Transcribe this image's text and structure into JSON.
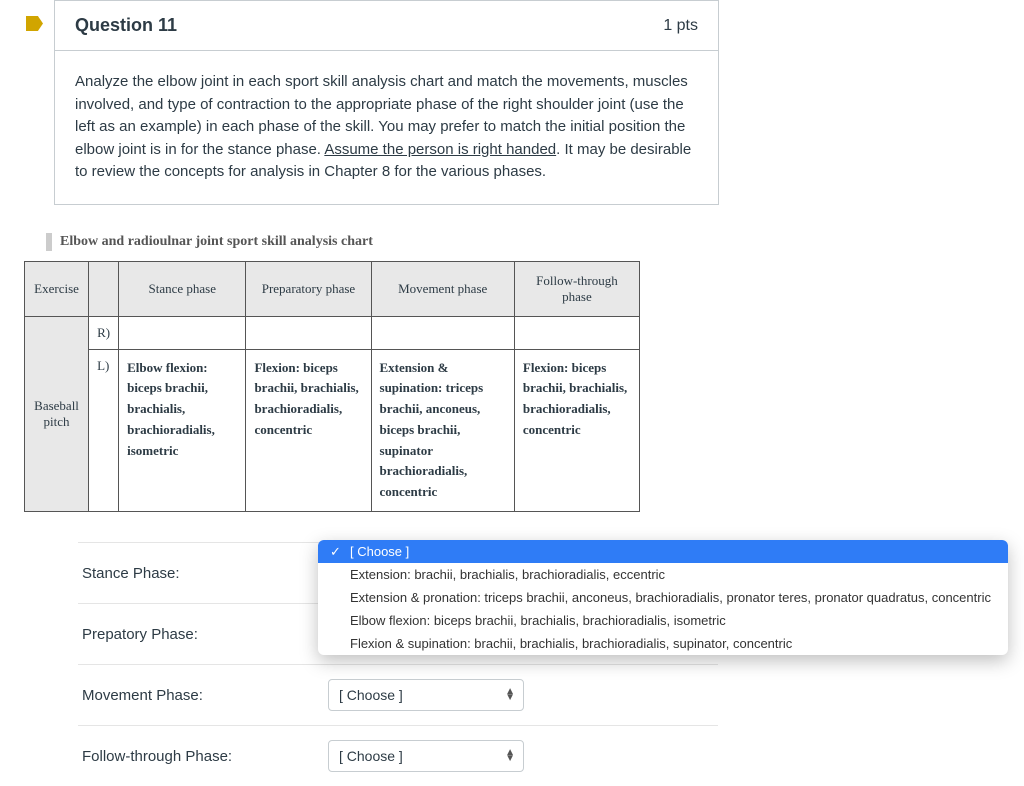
{
  "question": {
    "title": "Question 11",
    "points": "1 pts",
    "text_parts": {
      "p1": "Analyze the elbow joint in each sport skill analysis chart and match the movements, muscles involved, and type of contraction to the appropriate phase of the right shoulder joint (use the left as an example) in each phase of the skill. You may prefer to match the initial position the elbow joint is in for the stance phase. ",
      "underline": "Assume the person is right handed",
      "p2": ". It may be desirable to review the concepts for analysis in Chapter 8 for the various phases."
    }
  },
  "chart": {
    "title": "Elbow and radioulnar joint sport skill analysis chart",
    "headers": [
      "Exercise",
      "",
      "Stance phase",
      "Preparatory phase",
      "Movement phase",
      "Follow-through phase"
    ],
    "exercise": "Baseball pitch",
    "rows": {
      "r_label": "R)",
      "l_label": "L)",
      "l_cells": {
        "stance": "Elbow flexion: biceps brachii, brachialis, brachioradialis, isometric",
        "prep": "Flexion: biceps brachii, brachialis, brachioradialis, concentric",
        "move": "Extension & supination: triceps brachii, anconeus, biceps brachii, supinator brachioradialis, concentric",
        "follow": "Flexion: biceps brachii, brachialis, brachioradialis, concentric"
      }
    }
  },
  "match": {
    "rows": [
      {
        "label": "Stance Phase:",
        "value": "[ Choose ]"
      },
      {
        "label": "Prepatory Phase:",
        "value": "[ Choose ]"
      },
      {
        "label": "Movement Phase:",
        "value": "[ Choose ]"
      },
      {
        "label": "Follow-through Phase:",
        "value": "[ Choose ]"
      }
    ]
  },
  "dropdown": {
    "options": [
      "[ Choose ]",
      "Extension: brachii, brachialis, brachioradialis, eccentric",
      "Extension & pronation: triceps brachii, anconeus, brachioradialis, pronator teres, pronator quadratus, concentric",
      "Elbow flexion: biceps brachii, brachialis, brachioradialis, isometric",
      "Flexion & supination: brachii, brachialis, brachioradialis, supinator, concentric"
    ],
    "selected_index": 0
  }
}
